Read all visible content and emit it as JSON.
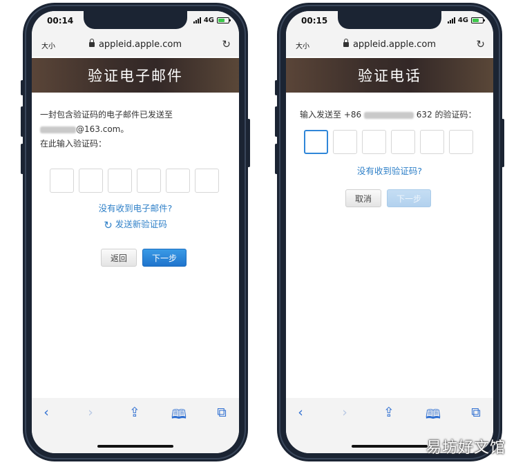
{
  "left_phone": {
    "status": {
      "time": "00:14",
      "network": "4G"
    },
    "browser": {
      "text_size_label": "大小",
      "url": "appleid.apple.com"
    },
    "banner_title": "验证电子邮件",
    "instruction_line1": "一封包含验证码的电子邮件已发送至",
    "email_suffix": "@163.com。",
    "instruction_line2": "在此输入验证码：",
    "code_boxes": 6,
    "no_email_link": "没有收到电子邮件?",
    "resend_link": "发送新验证码",
    "back_button": "返回",
    "next_button": "下一步"
  },
  "right_phone": {
    "status": {
      "time": "00:15",
      "network": "4G"
    },
    "browser": {
      "text_size_label": "大小",
      "url": "appleid.apple.com"
    },
    "banner_title": "验证电话",
    "instruction_prefix": "输入发送至 +86",
    "instruction_suffix": "632 的验证码：",
    "code_boxes": 6,
    "no_code_link": "没有收到验证码?",
    "cancel_button": "取消",
    "next_button": "下一步"
  },
  "icons": [
    "back-icon",
    "forward-icon",
    "share-icon",
    "bookmarks-icon",
    "tabs-icon",
    "reload-icon",
    "lock-icon",
    "refresh-icon"
  ],
  "watermark": "易坊好文馆",
  "colors": {
    "accent": "#2f80c8",
    "banner": "#3b2e2a",
    "frame": "#1b2433"
  }
}
